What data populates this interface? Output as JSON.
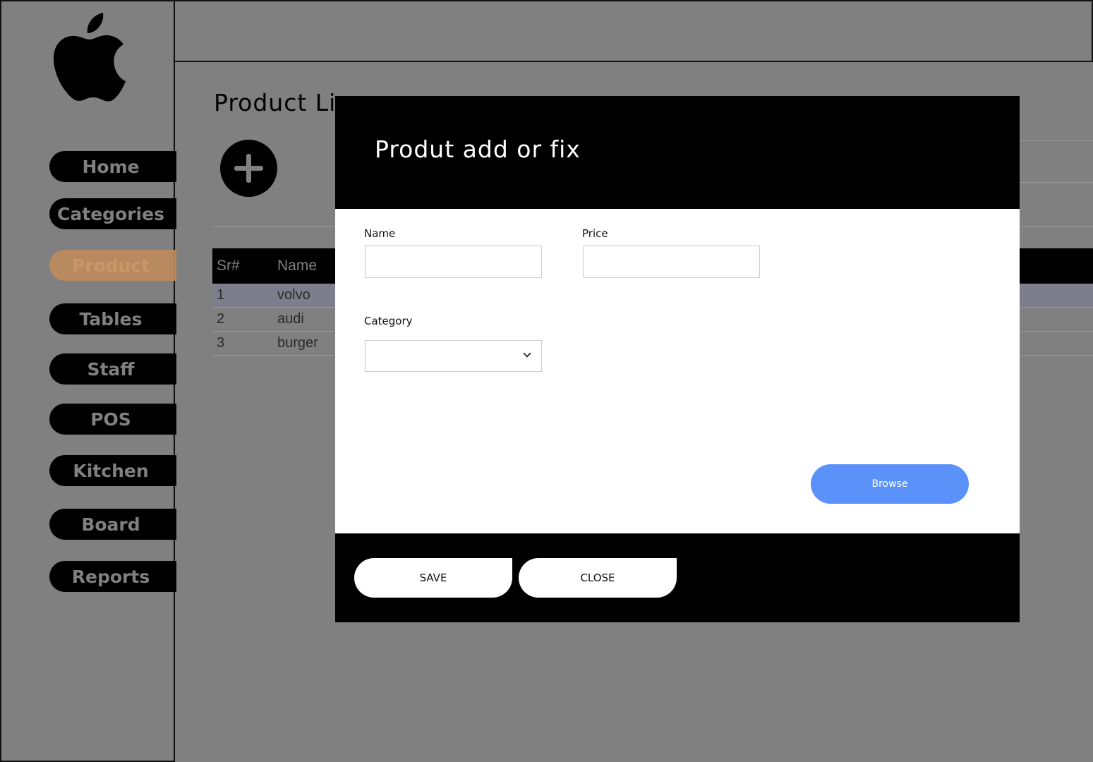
{
  "sidebar": {
    "items": [
      {
        "label": "Home"
      },
      {
        "label": "Categories"
      },
      {
        "label": "Product",
        "active": true
      },
      {
        "label": "Tables"
      },
      {
        "label": "Staff"
      },
      {
        "label": "POS"
      },
      {
        "label": "Kitchen"
      },
      {
        "label": "Board"
      },
      {
        "label": "Reports"
      }
    ],
    "active_color": "#c08a5c"
  },
  "page": {
    "title": "Product Li"
  },
  "table": {
    "headers": [
      "Sr#",
      "Name"
    ],
    "rows": [
      {
        "sr": "1",
        "name": "volvo",
        "selected": true
      },
      {
        "sr": "2",
        "name": "audi"
      },
      {
        "sr": "3",
        "name": "burger"
      }
    ]
  },
  "modal": {
    "title": "Produt add or fix",
    "name_label": "Name",
    "name_value": "",
    "price_label": "Price",
    "price_value": "",
    "category_label": "Category",
    "category_value": "",
    "browse_label": "Browse",
    "save_label": "SAVE",
    "close_label": "CLOSE",
    "browse_color": "#5b92fa"
  }
}
